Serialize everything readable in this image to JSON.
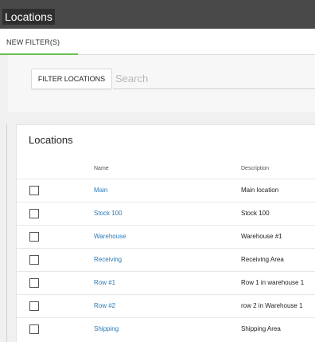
{
  "header": {
    "title": "Locations"
  },
  "tabs": [
    {
      "label": "NEW FILTER(S)",
      "active": true
    }
  ],
  "filter": {
    "button_label": "FILTER LOCATIONS",
    "search_placeholder": "Search"
  },
  "panel": {
    "title": "Locations",
    "columns": {
      "name": "Name",
      "description": "Description"
    },
    "rows": [
      {
        "name": "Main",
        "description": "Main location",
        "checked": false
      },
      {
        "name": "Stock 100",
        "description": "Stock 100",
        "checked": false
      },
      {
        "name": "Warehouse",
        "description": "Warehouse #1",
        "checked": false
      },
      {
        "name": "Receiving",
        "description": "Receiving Area",
        "checked": false
      },
      {
        "name": "Row #1",
        "description": "Row 1 in warehouse 1",
        "checked": false
      },
      {
        "name": "Row #2",
        "description": "row 2 in Warehouse 1",
        "checked": false
      },
      {
        "name": "Shipping",
        "description": "Shipping Area",
        "checked": false
      }
    ]
  },
  "colors": {
    "header_bg": "#494949",
    "tab_underline": "#6abf4b",
    "link": "#2a7ab8"
  }
}
